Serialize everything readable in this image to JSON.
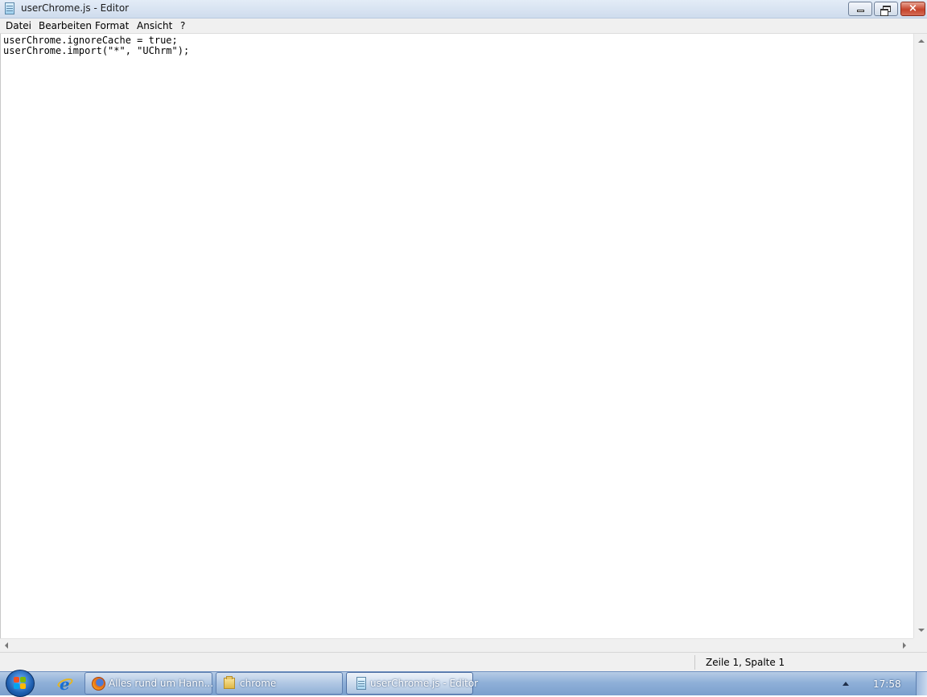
{
  "window": {
    "title": "userChrome.js - Editor",
    "icon": "notepad-icon",
    "controls": {
      "minimize": "minimize-icon",
      "maximize": "restore-icon",
      "close": "×"
    }
  },
  "menubar": {
    "items": [
      "Datei",
      "Bearbeiten",
      "Format",
      "Ansicht",
      "?"
    ]
  },
  "editor": {
    "lines": [
      "userChrome.ignoreCache = true;",
      "userChrome.import(\"*\", \"UChrm\");"
    ]
  },
  "statusbar": {
    "position": "Zeile 1, Spalte 1"
  },
  "taskbar": {
    "start_icon": "windows-start-icon",
    "pinned": [
      {
        "icon": "internet-explorer-icon"
      }
    ],
    "buttons": [
      {
        "icon": "firefox-icon",
        "label": "Alles rund um Hann..."
      },
      {
        "icon": "folder-icon",
        "label": "chrome"
      },
      {
        "icon": "notepad-icon",
        "label": "userChrome.js - Editor",
        "active": true
      }
    ],
    "clock": "17:58"
  },
  "colors": {
    "titlebar": "#dbe6f4",
    "taskbar": "#8fb0d8",
    "close_button": "#c5432b"
  }
}
